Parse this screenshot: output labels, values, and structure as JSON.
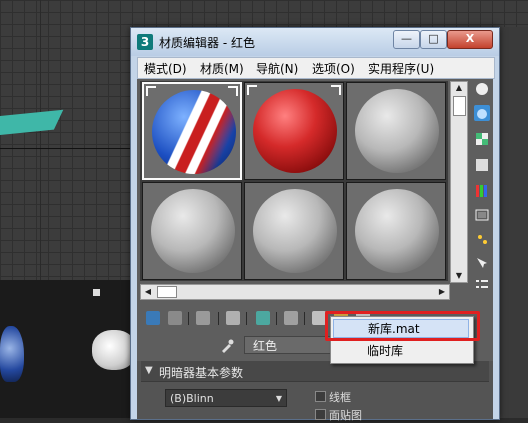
{
  "window": {
    "title": "材质编辑器 - 红色",
    "app_icon_text": "3",
    "minimize": "—",
    "maximize": "□",
    "close": "X"
  },
  "menubar": {
    "items": [
      {
        "label": "模式(D)"
      },
      {
        "label": "材质(M)"
      },
      {
        "label": "导航(N)"
      },
      {
        "label": "选项(O)"
      },
      {
        "label": "实用程序(U)"
      }
    ]
  },
  "sample_slots": [
    {
      "material": "beach-ball",
      "selected": true
    },
    {
      "material": "red",
      "selected": false
    },
    {
      "material": "default-grey",
      "selected": false
    },
    {
      "material": "default-grey",
      "selected": false
    },
    {
      "material": "default-grey",
      "selected": false
    },
    {
      "material": "default-grey",
      "selected": false
    }
  ],
  "material_name": {
    "value": "红色"
  },
  "rollout": {
    "title": "明暗器基本参数",
    "shader": "(B)Blinn",
    "options": [
      {
        "label": "线框"
      },
      {
        "label": "面贴图"
      }
    ]
  },
  "dropdown": {
    "items": [
      {
        "label": "新库.mat",
        "highlighted": true
      },
      {
        "label": "临时库",
        "highlighted": false
      }
    ]
  },
  "colors": {
    "highlight_box": "#e02020",
    "red_material": "#d52a2a"
  },
  "icons": [
    "sample-type-icon",
    "backlight-icon",
    "background-icon",
    "sample-uv-icon",
    "video-color-check-icon",
    "make-preview-icon",
    "options-icon",
    "select-by-material-icon",
    "material-map-navigator-icon",
    "get-material-icon",
    "put-to-scene-icon",
    "assign-to-selection-icon",
    "reset-map-icon",
    "make-unique-icon",
    "put-to-library-icon",
    "material-id-icon",
    "show-map-icon",
    "show-end-result-icon",
    "eyedropper-icon"
  ]
}
